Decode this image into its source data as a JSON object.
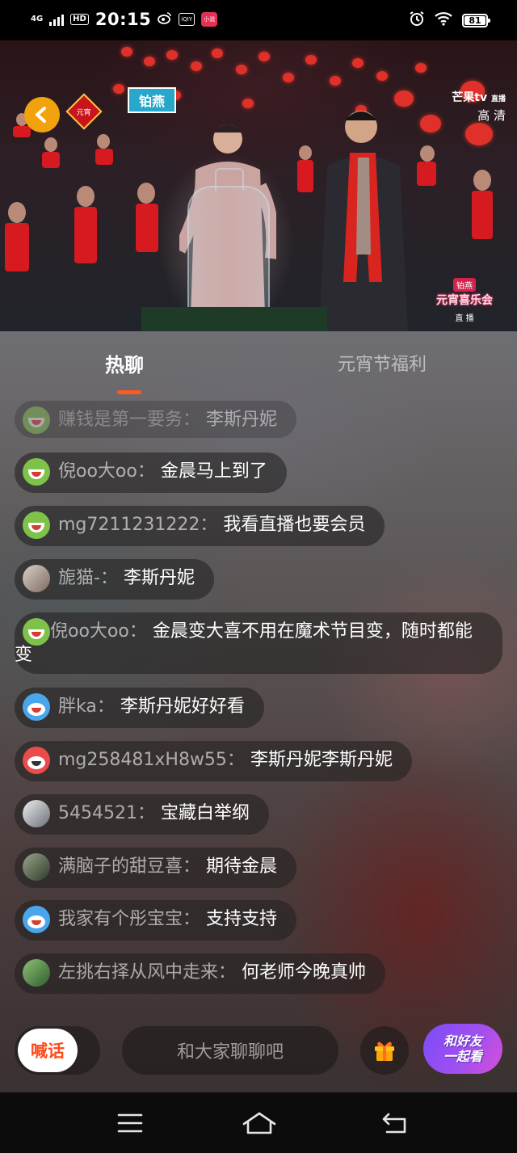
{
  "status_bar": {
    "time": "20:15",
    "network": "4G",
    "hd": "HD",
    "iqiyi": "iQIY",
    "app_badge": "小说",
    "battery": "81"
  },
  "video": {
    "corner_logo": "元宵",
    "sponsor_sign": "铂燕",
    "brand": "芒果tv",
    "brand_live": "直播",
    "quality": "高 清",
    "show_sponsor": "铂燕",
    "show_title": "元宵喜乐会",
    "live_label": "直 播"
  },
  "tabs": {
    "hot_chat": "热聊",
    "welfare": "元宵节福利"
  },
  "messages": [
    {
      "user": "赚钱是第一要务：",
      "text": "李斯丹妮",
      "avatar": "green-smile-avatar"
    },
    {
      "user": "倪oo大oo：",
      "text": "金晨马上到了",
      "avatar": "green-smile-avatar"
    },
    {
      "user": "mg7211231222：",
      "text": "我看直播也要会员",
      "avatar": "green-smile-avatar"
    },
    {
      "user": "旎猫-：",
      "text": "李斯丹妮",
      "avatar": "photo-avatar"
    },
    {
      "user": "倪oo大oo：",
      "text": "金晨变大喜不用在魔术节目变，随时都能变",
      "avatar": "green-smile-avatar"
    },
    {
      "user": "胖ka：",
      "text": "李斯丹妮好好看",
      "avatar": "blue-mascot-avatar"
    },
    {
      "user": "mg258481xH8w55：",
      "text": "李斯丹妮李斯丹妮",
      "avatar": "red-mascot-avatar"
    },
    {
      "user": "5454521：",
      "text": "宝藏白举纲",
      "avatar": "photo-avatar"
    },
    {
      "user": "满脑子的甜豆喜：",
      "text": "期待金晨",
      "avatar": "photo-avatar"
    },
    {
      "user": "我家有个彤宝宝：",
      "text": "支持支持",
      "avatar": "blue-mascot-avatar"
    },
    {
      "user": "左挑右择从风中走来：",
      "text": "何老师今晚真帅",
      "avatar": "photo-avatar"
    }
  ],
  "bottom_bar": {
    "shout_label": "喊话",
    "input_placeholder": "和大家聊聊吧",
    "watch_together_line1": "和好友",
    "watch_together_line2": "一起看"
  },
  "colors": {
    "accent_orange": "#ff5a1f",
    "watch_gradient_start": "#7a4df7",
    "watch_gradient_end": "#d64fd8"
  }
}
